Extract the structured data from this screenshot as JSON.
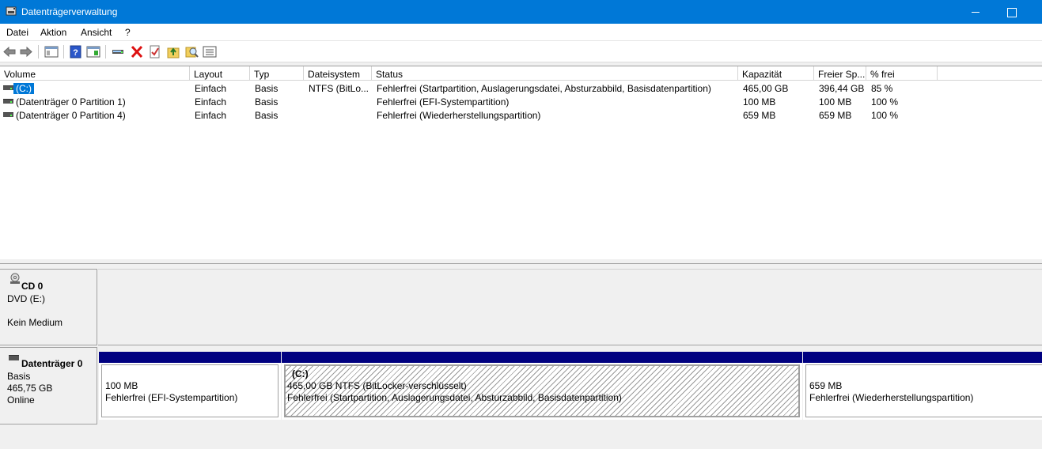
{
  "window": {
    "title": "Datenträgerverwaltung",
    "controls": [
      "minimize",
      "maximize"
    ]
  },
  "menu": [
    "Datei",
    "Aktion",
    "Ansicht",
    "?"
  ],
  "toolbar": {
    "buttons": [
      "back-icon",
      "forward-icon",
      "console-tree-icon",
      "help-icon",
      "properties-icon",
      "connect-icon",
      "delete-icon",
      "check-icon",
      "folder-up-icon",
      "search-icon",
      "list-icon"
    ]
  },
  "columns": [
    "Volume",
    "Layout",
    "Typ",
    "Dateisystem",
    "Status",
    "Kapazität",
    "Freier Sp...",
    "% frei"
  ],
  "volumes": [
    {
      "volume": "(C:)",
      "layout": "Einfach",
      "typ": "Basis",
      "fs": "NTFS (BitLo...",
      "status": "Fehlerfrei (Startpartition, Auslagerungsdatei, Absturzabbild, Basisdatenpartition)",
      "capacity": "465,00 GB",
      "free": "396,44 GB",
      "pct": "85 %",
      "selected": true
    },
    {
      "volume": "(Datenträger 0 Partition 1)",
      "layout": "Einfach",
      "typ": "Basis",
      "fs": "",
      "status": "Fehlerfrei (EFI-Systempartition)",
      "capacity": "100 MB",
      "free": "100 MB",
      "pct": "100 %",
      "selected": false
    },
    {
      "volume": "(Datenträger 0 Partition 4)",
      "layout": "Einfach",
      "typ": "Basis",
      "fs": "",
      "status": "Fehlerfrei (Wiederherstellungspartition)",
      "capacity": "659 MB",
      "free": "659 MB",
      "pct": "100 %",
      "selected": false
    }
  ],
  "cd": {
    "name": "CD 0",
    "drive": "DVD (E:)",
    "media": "Kein Medium"
  },
  "disk0": {
    "name": "Datenträger 0",
    "type": "Basis",
    "size": "465,75 GB",
    "state": "Online",
    "partitions": [
      {
        "title": "",
        "line1": "100 MB",
        "line2": "Fehlerfrei (EFI-Systempartition)"
      },
      {
        "title": "(C:)",
        "line1": "465,00 GB NTFS (BitLocker-verschlüsselt)",
        "line2": "Fehlerfrei (Startpartition, Auslagerungsdatei, Absturzabbild, Basisdatenpartition)"
      },
      {
        "title": "",
        "line1": "659 MB",
        "line2": "Fehlerfrei (Wiederherstellungspartition)"
      }
    ]
  },
  "colors": {
    "titlebar": "#0078d7",
    "partition_bar": "#000080",
    "selection": "#0078d7"
  }
}
